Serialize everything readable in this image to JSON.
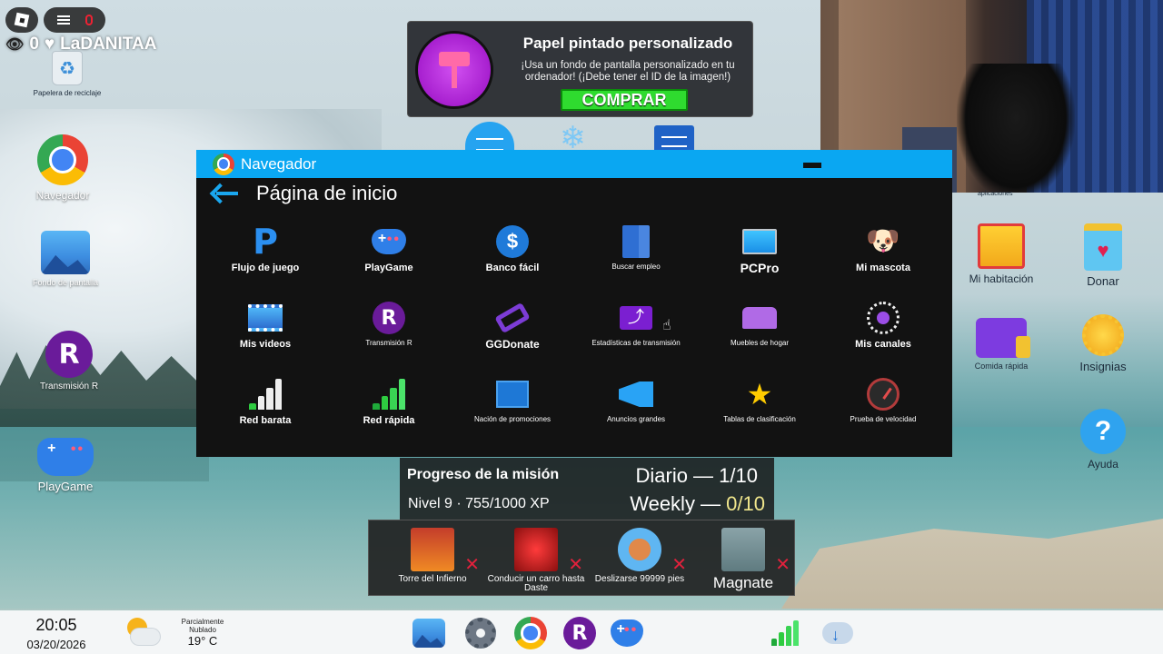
{
  "overlay": {
    "viewer_count": "0",
    "username": "LaDANITAA"
  },
  "ad": {
    "title": "Papel pintado personalizado",
    "description": "¡Usa un fondo de pantalla personalizado en tu ordenador! (¡Debe tener el ID de la imagen!)",
    "button_label": "COMPRAR"
  },
  "desktop_left": {
    "recycle": "Papelera de reciclaje",
    "browser": "Navegador",
    "wallpaper": "Fondo de pantalla",
    "stream": "Transmisión R",
    "playgame": "PlayGame"
  },
  "browser": {
    "window_title": "Navegador",
    "page_title": "Página de inicio",
    "apps": [
      {
        "label": "Flujo de juego",
        "icon": "paypal-icon"
      },
      {
        "label": "PlayGame",
        "icon": "gamepad-icon"
      },
      {
        "label": "Banco fácil",
        "icon": "bank-coin-icon"
      },
      {
        "label": "Buscar empleo",
        "icon": "building-icon"
      },
      {
        "label": "PCPro",
        "icon": "monitor-icon"
      },
      {
        "label": "Mi mascota",
        "icon": "pets-icon"
      },
      {
        "label": "Mis videos",
        "icon": "film-icon"
      },
      {
        "label": "Transmisión R",
        "icon": "r-logo-icon"
      },
      {
        "label": "GGDonate",
        "icon": "ggdonate-icon"
      },
      {
        "label": "Estadísticas de transmisión",
        "icon": "stream-stats-icon"
      },
      {
        "label": "Muebles de hogar",
        "icon": "bed-icon"
      },
      {
        "label": "Mis canales",
        "icon": "channels-icon"
      },
      {
        "label": "Red barata",
        "icon": "signal-bars-icon"
      },
      {
        "label": "Red rápida",
        "icon": "signal-bars-green-icon"
      },
      {
        "label": "Nación de promociones",
        "icon": "stats-board-icon"
      },
      {
        "label": "Anuncios grandes",
        "icon": "megaphone-icon"
      },
      {
        "label": "Tablas de clasificación",
        "icon": "medal-icon"
      },
      {
        "label": "Prueba de velocidad",
        "icon": "speedometer-icon"
      }
    ]
  },
  "desktop_right": {
    "top_left_partial": "aplicaciones",
    "room": "Mi habitación",
    "donate": "Donar",
    "food": "Comida rápida",
    "badges": "Insignias",
    "help": "Ayuda"
  },
  "mission": {
    "title": "Progreso de la misión",
    "level": "Nivel 9 · 755/1000 XP",
    "daily": "Diario — 1/10",
    "weekly_prefix": "Weekly — ",
    "weekly_value": "0/10",
    "highlight_color": "#f0e68c"
  },
  "quests": [
    {
      "label": "Torre del Infierno"
    },
    {
      "label": "Conducir un carro hasta Daste"
    },
    {
      "label": "Deslizarse 99999 pies"
    },
    {
      "label": "Magnate"
    }
  ],
  "taskbar": {
    "time": "20:05",
    "date": "03/20/2026",
    "weather_condition": "Parcialmente Nublado",
    "temperature": "19° C"
  },
  "colors": {
    "accent_blue": "#0aa7f2",
    "buy_green": "#2fdb2f",
    "fail_red": "#e0213c"
  }
}
